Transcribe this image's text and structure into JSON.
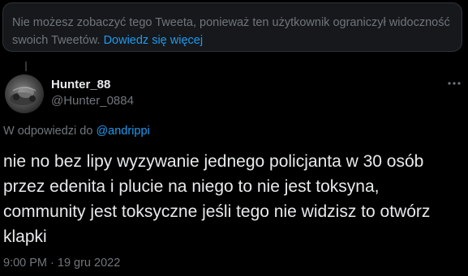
{
  "notice": {
    "text": "Nie możesz zobaczyć tego Tweeta, ponieważ ten użytkownik ograniczył widoczność swoich Tweetów.",
    "link": "Dowiedz się więcej"
  },
  "tweet": {
    "author": {
      "display_name": "Hunter_88",
      "handle": "@Hunter_0884"
    },
    "reply_to_prefix": "W odpowiedzi do",
    "reply_to_handle": "@andrippi",
    "text": "nie no bez lipy wyzywanie jednego policjanta w 30 osób przez edenita i plucie na niego to nie jest toksyna, community jest toksyczne jeśli tego nie widzisz to otwórz klapki",
    "timestamp": "9:00 PM · 19 gru 2022"
  },
  "icons": {
    "more": "more-dots-icon"
  },
  "colors": {
    "background": "#000000",
    "text_primary": "#e7e9ea",
    "text_secondary": "#71767b",
    "accent": "#1d9bf0",
    "border": "#2f3336"
  }
}
